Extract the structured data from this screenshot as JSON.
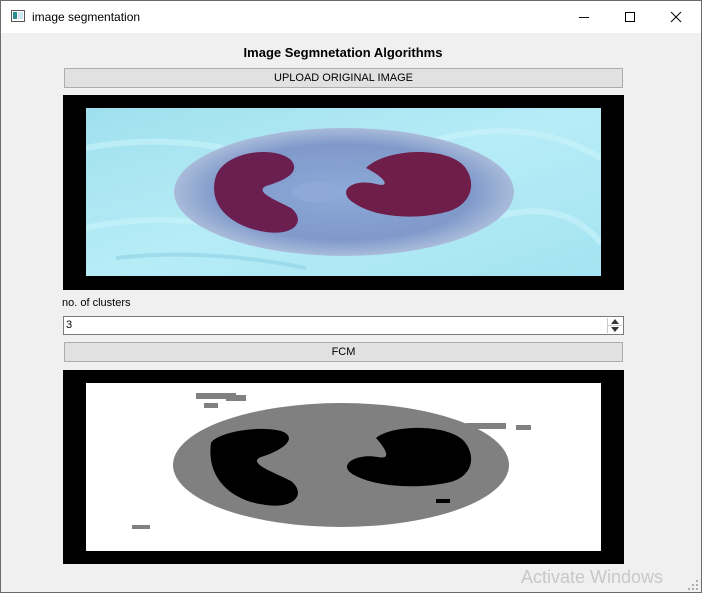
{
  "window": {
    "title": "image segmentation",
    "icon": "app-window-icon",
    "controls": [
      "minimize-icon",
      "maximize-icon",
      "close-icon"
    ]
  },
  "header": {
    "title": "Image Segmnetation Algorithms"
  },
  "upload": {
    "label": "UPLOAD ORIGINAL IMAGE"
  },
  "original_image": {
    "description_icon": "cell-image",
    "background_color": "#000000"
  },
  "clusters": {
    "label": "no. of clusters",
    "value": "3"
  },
  "fcm": {
    "label": "FCM"
  },
  "segmented_image": {
    "description_icon": "segmented-cell-image",
    "background_color": "#000000"
  },
  "watermark": {
    "text": "Activate Windows"
  }
}
